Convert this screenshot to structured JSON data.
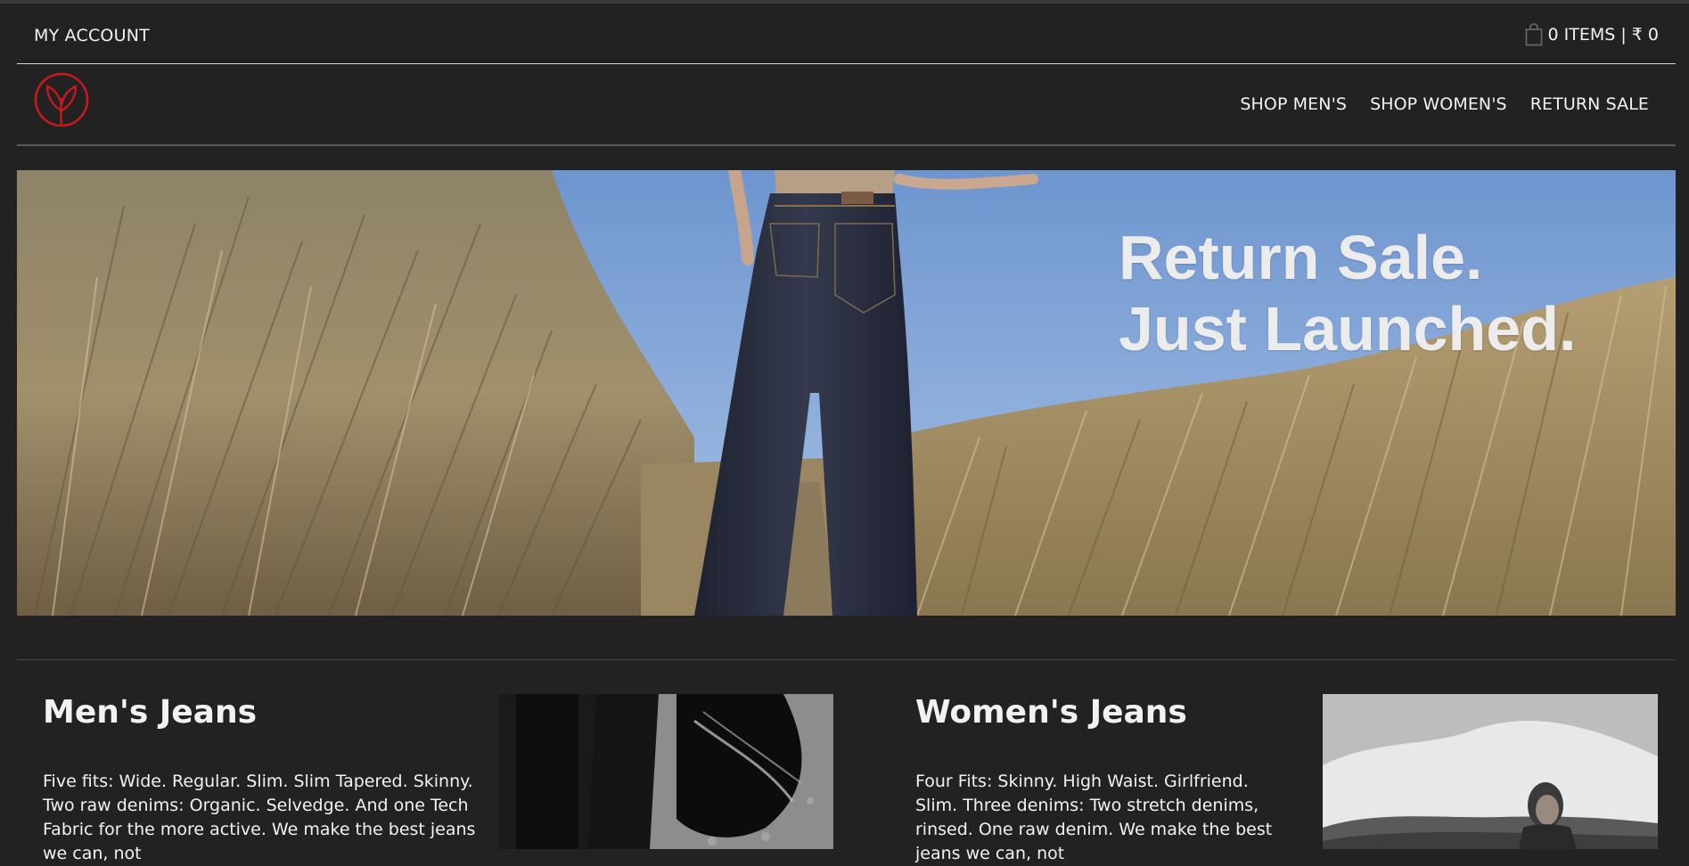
{
  "header": {
    "account_label": "MY ACCOUNT",
    "cart_label": "0 ITEMS | ₹ 0",
    "cart_icon": "shopping-bag-icon"
  },
  "nav": {
    "logo_icon": "leaf-in-circle-logo",
    "logo_color": "#c8191e",
    "links": [
      {
        "label": "SHOP MEN'S"
      },
      {
        "label": "SHOP WOMEN'S"
      },
      {
        "label": "RETURN SALE"
      }
    ]
  },
  "hero": {
    "line1": "Return Sale.",
    "line2": "Just Launched."
  },
  "sections": [
    {
      "title": "Men's Jeans",
      "text": "Five fits: Wide. Regular. Slim. Slim Tapered. Skinny. Two raw denims: Organic. Selvedge. And one Tech Fabric for the more active. We make the best jeans we can, not"
    },
    {
      "title": "Women's Jeans",
      "text": "Four Fits: Skinny. High Waist. Girlfriend. Slim. Three denims: Two stretch denims, rinsed. One raw denim. We make the best jeans we can, not"
    }
  ],
  "colors": {
    "background": "#222222",
    "text": "#f2f2f2",
    "brand_red": "#c8191e"
  }
}
